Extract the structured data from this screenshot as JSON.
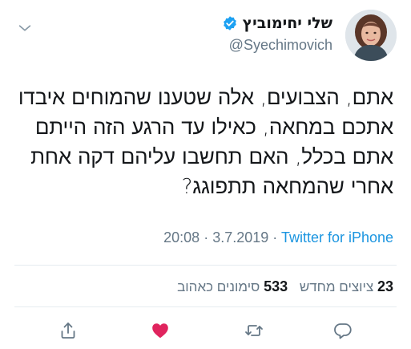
{
  "author": {
    "display_name": "שלי יחימוביץ",
    "handle": "@Syechimovich",
    "verified": true
  },
  "tweet": {
    "lines": [
      "אתם, הצבועים, אלה שטענו שהמוחים איבדו",
      "אתכם במחאה, כאילו עד הרגע הזה הייתם",
      "אתם בכלל, האם תחשבו עליהם דקה אחת",
      "אחרי שהמחאה תתפוגג?"
    ]
  },
  "meta": {
    "time": "20:08",
    "separator1": " · ",
    "date": "3.7.2019",
    "separator2": " · ",
    "source": "Twitter for iPhone"
  },
  "stats": {
    "retweets_count": "23",
    "retweets_label": "ציוצים מחדש",
    "likes_count": "533",
    "likes_label": "סימונים כאהוב"
  },
  "icons": {
    "verified": "verified-badge-icon",
    "menu": "chevron-down-icon",
    "share": "share-icon",
    "like": "heart-icon",
    "retweet": "retweet-icon",
    "reply": "reply-icon"
  },
  "colors": {
    "verified": "#1da1f2",
    "link": "#1b95e0",
    "like": "#e0245e",
    "muted": "#657786",
    "text": "#14171a"
  }
}
